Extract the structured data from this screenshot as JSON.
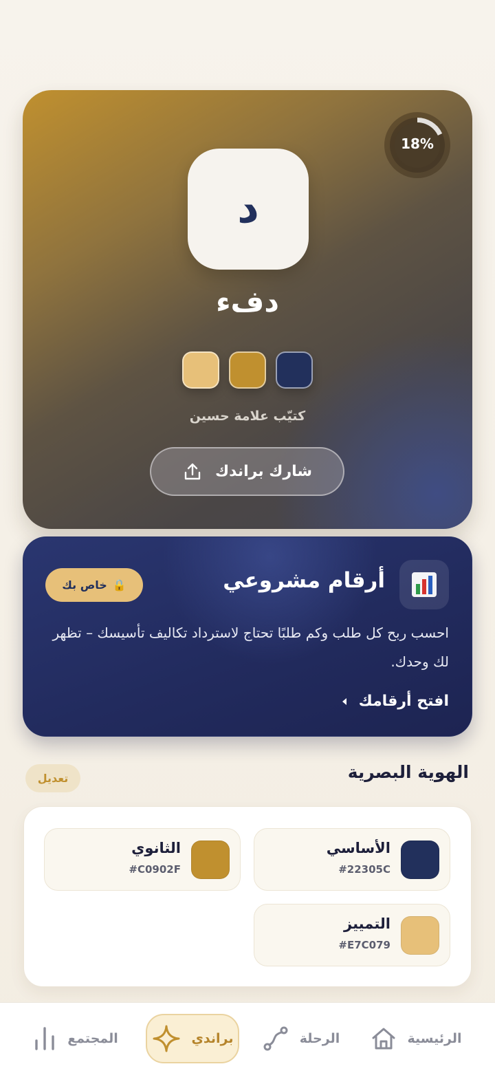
{
  "hero": {
    "progress_percent": 18,
    "progress_label": "18%",
    "logo_letter": "د",
    "brand_name": "دفء",
    "swatch_colors": [
      "#E7C079",
      "#C0902F",
      "#22305C"
    ],
    "byline": "كتيّب علامة حسين",
    "share_label": "شارك براندك"
  },
  "numbers_card": {
    "title": "أرقام مشروعي",
    "badge_icon": "🔒",
    "badge_label": "خاص بك",
    "description": "احسب ربح كل طلب وكم طلبًا تحتاج لاسترداد تكاليف تأسيسك – تظهر لك وحدك.",
    "cta_label": "افتح أرقامك",
    "icon": "bar-chart-icon"
  },
  "identity": {
    "section_title": "الهوية البصرية",
    "edit_label": "تعديل",
    "colors": [
      {
        "name": "الأساسي",
        "hex": "#22305C"
      },
      {
        "name": "الثانوي",
        "hex": "#C0902F"
      },
      {
        "name": "التمييز",
        "hex": "#E7C079"
      }
    ]
  },
  "nav": {
    "items": [
      {
        "label": "الرئيسية",
        "icon": "home-icon"
      },
      {
        "label": "الرحلة",
        "icon": "route-icon"
      },
      {
        "label": "براندي",
        "icon": "sparkle-icon",
        "active": true
      },
      {
        "label": "المجتمع",
        "icon": "stats-icon"
      }
    ]
  },
  "colors": {
    "navy": "#22305C",
    "gold": "#C0902F",
    "sand": "#E7C079",
    "inactive": "#8A8C98"
  }
}
